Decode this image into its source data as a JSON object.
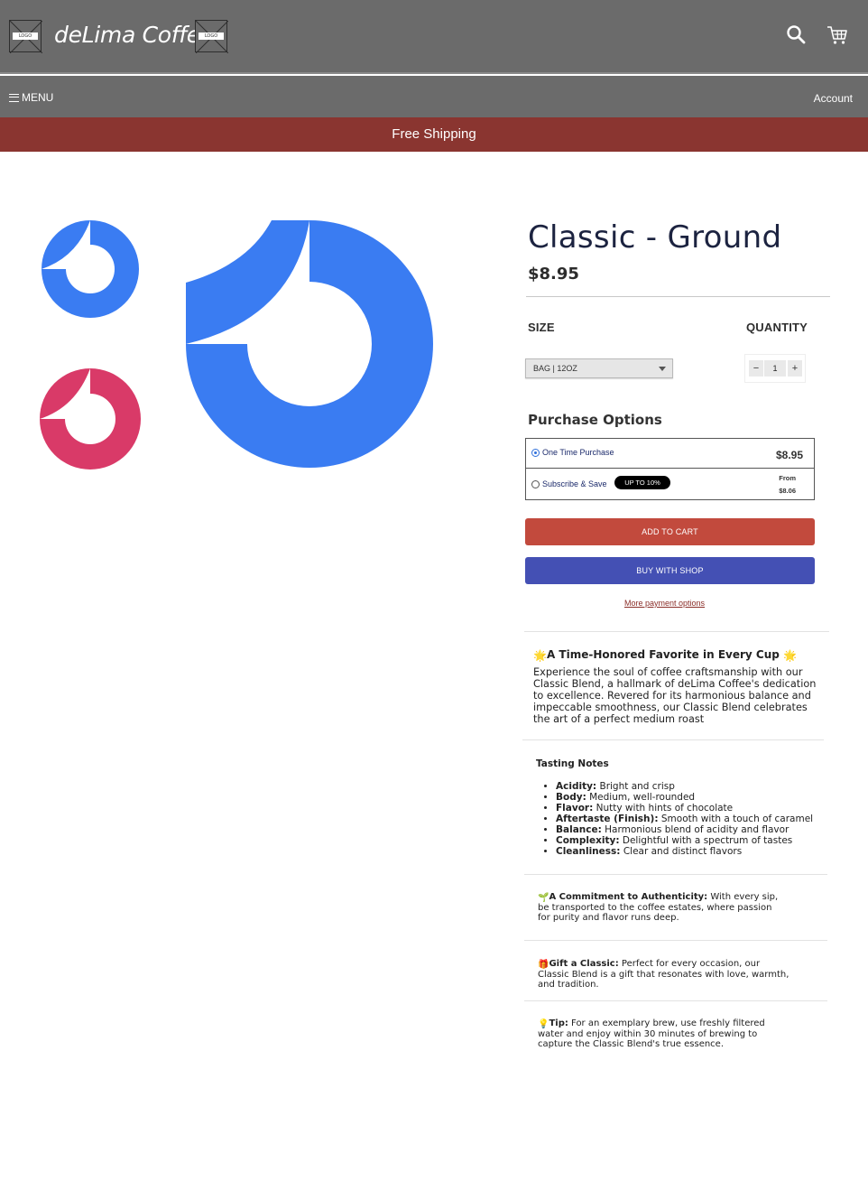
{
  "header": {
    "brand": "deLima Coffee",
    "logo_text": "LOGO",
    "icons": [
      "search-icon",
      "cart-icon"
    ]
  },
  "nav": {
    "menu_label": "MENU",
    "account_label": "Account"
  },
  "promo": {
    "text": "Free Shipping"
  },
  "product": {
    "title": "Classic - Ground",
    "price": "$8.95",
    "size_label": "SIZE",
    "quantity_label": "QUANTITY",
    "size_value": "BAG | 12OZ",
    "quantity_value": "1",
    "qty_minus": "−",
    "qty_plus": "+"
  },
  "purchase_options": {
    "title": "Purchase Options",
    "one_time": {
      "label": "One Time Purchase",
      "price": "$8.95",
      "selected": true
    },
    "subscribe": {
      "label": "Subscribe & Save",
      "badge": "UP TO 10%",
      "from_label": "From",
      "from_price": "$8.06",
      "selected": false
    }
  },
  "actions": {
    "add_to_cart": "ADD TO CART",
    "buy_with_shop": "BUY WITH SHOP",
    "more_payment": "More payment options"
  },
  "description": {
    "heading": "A Time-Honored Favorite in Every Cup",
    "body": "Experience the soul of coffee craftsmanship with our Classic Blend, a hallmark of deLima Coffee's dedication to excellence. Revered for its harmonious balance and impeccable smoothness, our Classic Blend celebrates the art of a perfect medium roast",
    "tasting_notes_title": "Tasting Notes",
    "tasting_notes": [
      {
        "term": "Acidity:",
        "text": "Bright and crisp"
      },
      {
        "term": "Body:",
        "text": "Medium, well-rounded"
      },
      {
        "term": "Flavor:",
        "text": "Nutty with hints of chocolate"
      },
      {
        "term": "Aftertaste (Finish):",
        "text": "Smooth with a touch of caramel"
      },
      {
        "term": "Balance:",
        "text": "Harmonious blend of acidity and flavor"
      },
      {
        "term": "Complexity:",
        "text": "Delightful with a spectrum of tastes"
      },
      {
        "term": "Cleanliness:",
        "text": "Clear and distinct flavors"
      }
    ],
    "authenticity_term": "A Commitment to Authenticity:",
    "authenticity_text": "With every sip, be transported to the coffee estates, where passion for purity and flavor runs deep.",
    "gift_term": "Gift a Classic:",
    "gift_text": "Perfect for every occasion, our Classic Blend is a gift that resonates with love, warmth, and tradition.",
    "tip_term": "Tip:",
    "tip_text": "For an exemplary brew, use freshly filtered water and enjoy within 30 minutes of brewing to capture the Classic Blend's true essence."
  },
  "colors": {
    "header_bg": "#6b6b6b",
    "promo_bg": "#8a3530",
    "title": "#1c2340",
    "product_blue": "#3a7cf2",
    "product_pink": "#d93a68",
    "add_to_cart": "#c24a3d",
    "buy_with_shop": "#4450b4"
  }
}
